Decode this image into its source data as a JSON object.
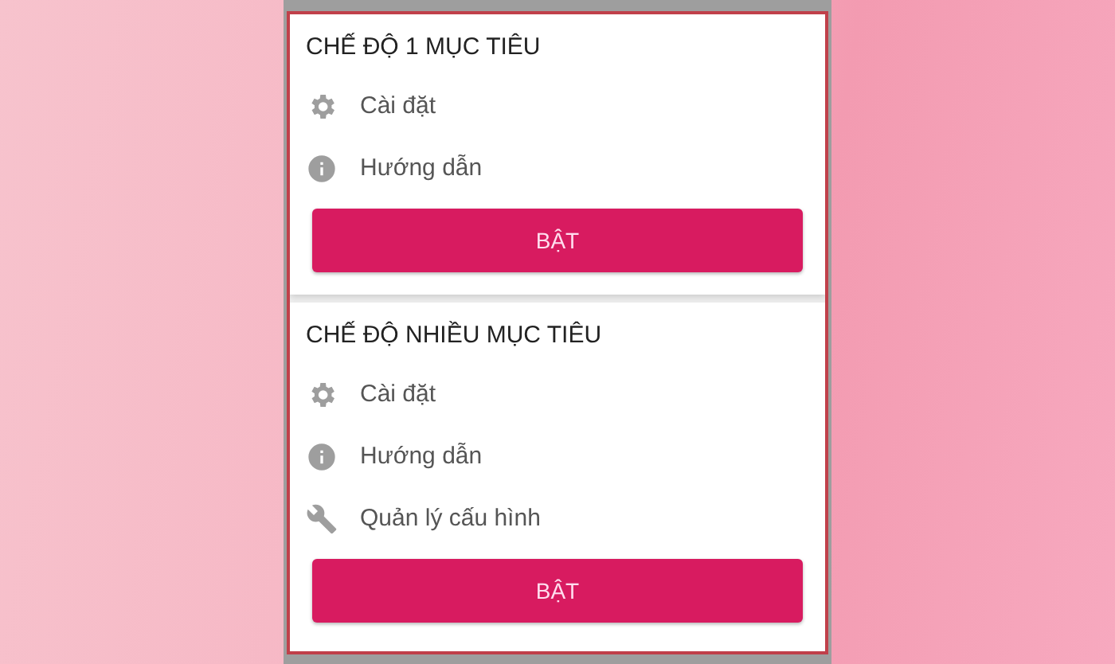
{
  "sections": [
    {
      "title": "CHẾ ĐỘ 1 MỤC TIÊU",
      "items": [
        {
          "kind": "settings",
          "label": "Cài đặt"
        },
        {
          "kind": "info",
          "label": "Hướng dẫn"
        }
      ],
      "button": "BẬT"
    },
    {
      "title": "CHẾ ĐỘ NHIỀU MỤC TIÊU",
      "items": [
        {
          "kind": "settings",
          "label": "Cài đặt"
        },
        {
          "kind": "info",
          "label": "Hướng dẫn"
        },
        {
          "kind": "wrench",
          "label": "Quản lý cấu hình"
        }
      ],
      "button": "BẬT"
    }
  ]
}
